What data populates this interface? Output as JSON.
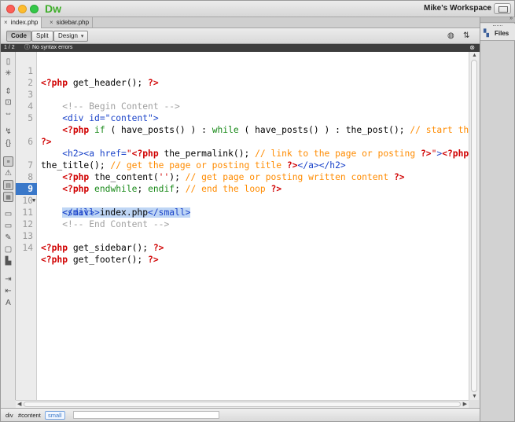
{
  "app": {
    "logo": "Dw",
    "workspace": "Mike's Workspace"
  },
  "tabs": [
    {
      "label": "index.php",
      "close": "×"
    },
    {
      "label": "sidebar.php",
      "close": "×"
    }
  ],
  "toolbar": {
    "code": "Code",
    "split": "Split",
    "design": "Design"
  },
  "errorbar": {
    "nav": "1 / 2",
    "message": "No syntax errors",
    "close": "⊗"
  },
  "editor": {
    "current_line": "9",
    "lines": [
      {
        "n": "1"
      },
      {
        "n": "2"
      },
      {
        "n": "3"
      },
      {
        "n": "4"
      },
      {
        "n": "5"
      },
      {
        "n": ""
      },
      {
        "n": "6"
      },
      {
        "n": ""
      },
      {
        "n": "7"
      },
      {
        "n": "8"
      },
      {
        "n": "9"
      },
      {
        "n": "10"
      },
      {
        "n": "11"
      },
      {
        "n": "12"
      },
      {
        "n": "13"
      },
      {
        "n": "14"
      }
    ]
  },
  "statusbar": {
    "crumbs": [
      "div",
      "#content",
      "small"
    ]
  },
  "rightpanel": {
    "files_label": "Files"
  },
  "icons": [
    "files-icon",
    "settings-icon",
    "close-icon"
  ],
  "colors": {
    "php_delimiter": "#d00000",
    "html_tag": "#1a43c9",
    "comment": "#ff8b00",
    "keyword": "#1a8a1a",
    "current_line": "#3a78c9"
  }
}
